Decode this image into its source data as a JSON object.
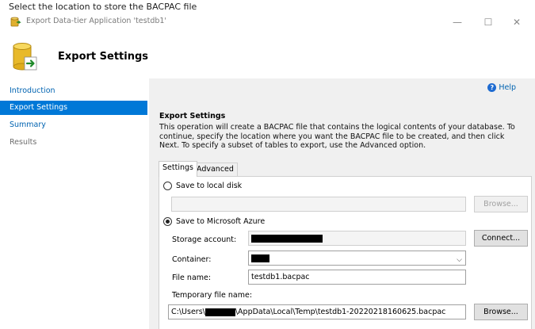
{
  "caption": "Select the location to store the BACPAC file",
  "window": {
    "title": "Export Data-tier Application 'testdb1'",
    "min_glyph": "—",
    "max_glyph": "☐",
    "close_glyph": "✕"
  },
  "header": {
    "title": "Export Settings"
  },
  "sidebar": {
    "items": [
      {
        "label": "Introduction"
      },
      {
        "label": "Export Settings"
      },
      {
        "label": "Summary"
      },
      {
        "label": "Results"
      }
    ]
  },
  "main": {
    "help_label": "Help",
    "section_title": "Export Settings",
    "section_desc": "This operation will create a BACPAC file that contains the logical contents of your database. To continue, specify the location where you want the BACPAC file to be created, and then click Next. To specify a subset of tables to export, use the Advanced option.",
    "tabs": [
      {
        "label": "Settings"
      },
      {
        "label": "Advanced"
      }
    ],
    "local_disk": {
      "label": "Save to local disk",
      "path_value": "",
      "browse_label": "Browse..."
    },
    "azure": {
      "label": "Save to Microsoft Azure",
      "storage_label": "Storage account:",
      "connect_label": "Connect...",
      "container_label": "Container:",
      "filename_label": "File name:",
      "filename_value": "testdb1.bacpac",
      "temp_label": "Temporary file name:",
      "temp_prefix": "C:\\Users\\",
      "temp_suffix": "\\AppData\\Local\\Temp\\testdb1-20220218160625.bacpac",
      "browse_label": "Browse..."
    }
  },
  "colors": {
    "accent": "#0078d7",
    "link": "#0063b1",
    "panel_bg": "#f0f0f0"
  },
  "icons": {
    "app": "database-export-icon",
    "header": "database-export-icon",
    "help": "help-icon",
    "dropdown": "chevron-down-icon"
  }
}
